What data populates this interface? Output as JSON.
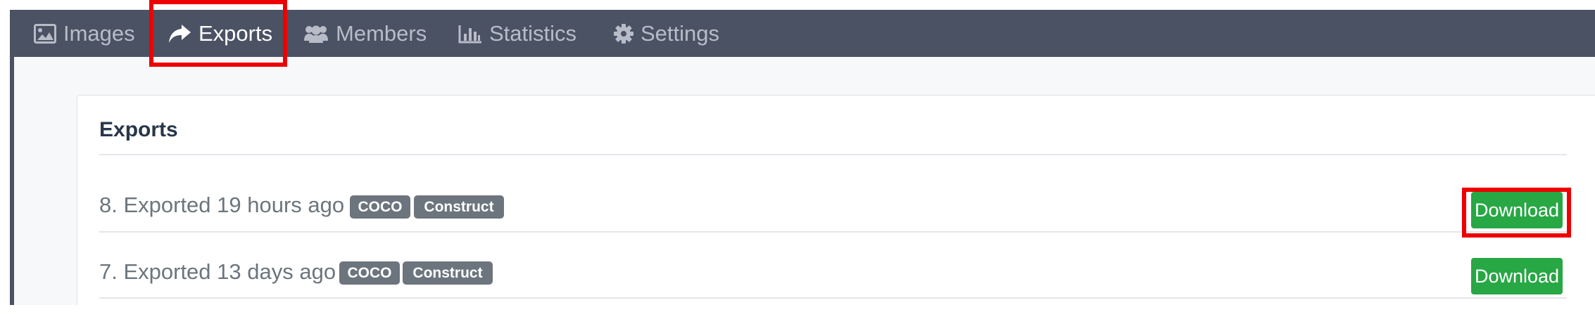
{
  "colors": {
    "navbar_bg": "#4b5264",
    "nav_inactive": "#b7bcc7",
    "nav_active": "#ffffff",
    "highlight": "#ee0000",
    "badge_bg": "#6c757d",
    "download_bg": "#28a745",
    "title_text": "#28374a",
    "row_text": "#6c757d"
  },
  "nav": {
    "tabs": [
      {
        "label": "Images",
        "icon": "image-icon",
        "active": false
      },
      {
        "label": "Exports",
        "icon": "share-arrow-icon",
        "active": true
      },
      {
        "label": "Members",
        "icon": "users-icon",
        "active": false
      },
      {
        "label": "Statistics",
        "icon": "bar-chart-icon",
        "active": false
      },
      {
        "label": "Settings",
        "icon": "gear-icon",
        "active": false
      }
    ]
  },
  "exports": {
    "title": "Exports",
    "rows": [
      {
        "text": "8. Exported 19 hours ago",
        "tags": [
          "COCO",
          "Construct"
        ],
        "button": "Download"
      },
      {
        "text": "7. Exported 13 days ago",
        "tags": [
          "COCO",
          "Construct"
        ],
        "button": "Download"
      }
    ]
  }
}
